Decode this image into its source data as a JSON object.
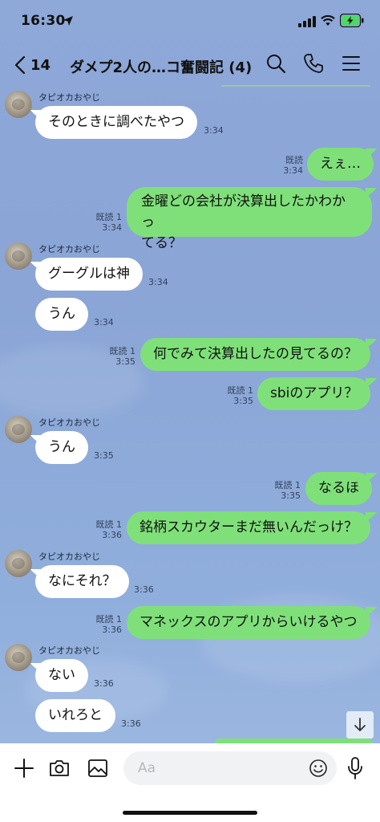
{
  "status_bar": {
    "time": "16:30"
  },
  "header": {
    "back_count": "14",
    "title": "ダメプ2人の…コ奮闘記 (4)"
  },
  "messages": [
    {
      "sender": "タピオカおやじ",
      "text": "そのときに調べたやつ",
      "time": "3:34"
    },
    {
      "read": "既読",
      "text": "えぇ…",
      "time": "3:34"
    },
    {
      "read": "既読 1",
      "text_line1": "金曜どの会社が決算出したかわかっ",
      "text_line2": "てる？",
      "time": "3:34"
    },
    {
      "sender": "タピオカおやじ",
      "text": "グーグルは神",
      "time": "3:34"
    },
    {
      "text": "うん",
      "time": "3:34"
    },
    {
      "read": "既読 1",
      "text": "何でみて決算出したの見てるの？",
      "time": "3:35"
    },
    {
      "read": "既読 1",
      "text": "sbiのアプリ？",
      "time": "3:35"
    },
    {
      "sender": "タピオカおやじ",
      "text": "うん",
      "time": "3:35"
    },
    {
      "read": "既読 1",
      "text": "なるほ",
      "time": "3:35"
    },
    {
      "read": "既読 1",
      "text": "銘柄スカウターまだ無いんだっけ？",
      "time": "3:36"
    },
    {
      "sender": "タピオカおやじ",
      "text": "なにそれ？",
      "time": "3:36"
    },
    {
      "read": "既読 1",
      "text": "マネックスのアプリからいけるやつ",
      "time": "3:36"
    },
    {
      "sender": "タピオカおやじ",
      "text": "ない",
      "time": "3:36"
    },
    {
      "text": "いれろと",
      "time": "3:36"
    }
  ],
  "input": {
    "placeholder": "Aa"
  },
  "icons": {
    "status": [
      "location-arrow-icon",
      "signal-icon",
      "wifi-icon",
      "battery-charging-icon"
    ],
    "header": [
      "back-chevron-icon",
      "search-icon",
      "phone-icon",
      "menu-icon"
    ],
    "input_bar": [
      "plus-icon",
      "camera-icon",
      "image-icon",
      "emoji-icon",
      "mic-icon"
    ],
    "scroll": "arrow-down-icon"
  },
  "colors": {
    "chat_bg": "#8aa6d6",
    "bubble_out": "#7fe07a",
    "bubble_in": "#ffffff",
    "battery_fill": "#4cd964"
  }
}
